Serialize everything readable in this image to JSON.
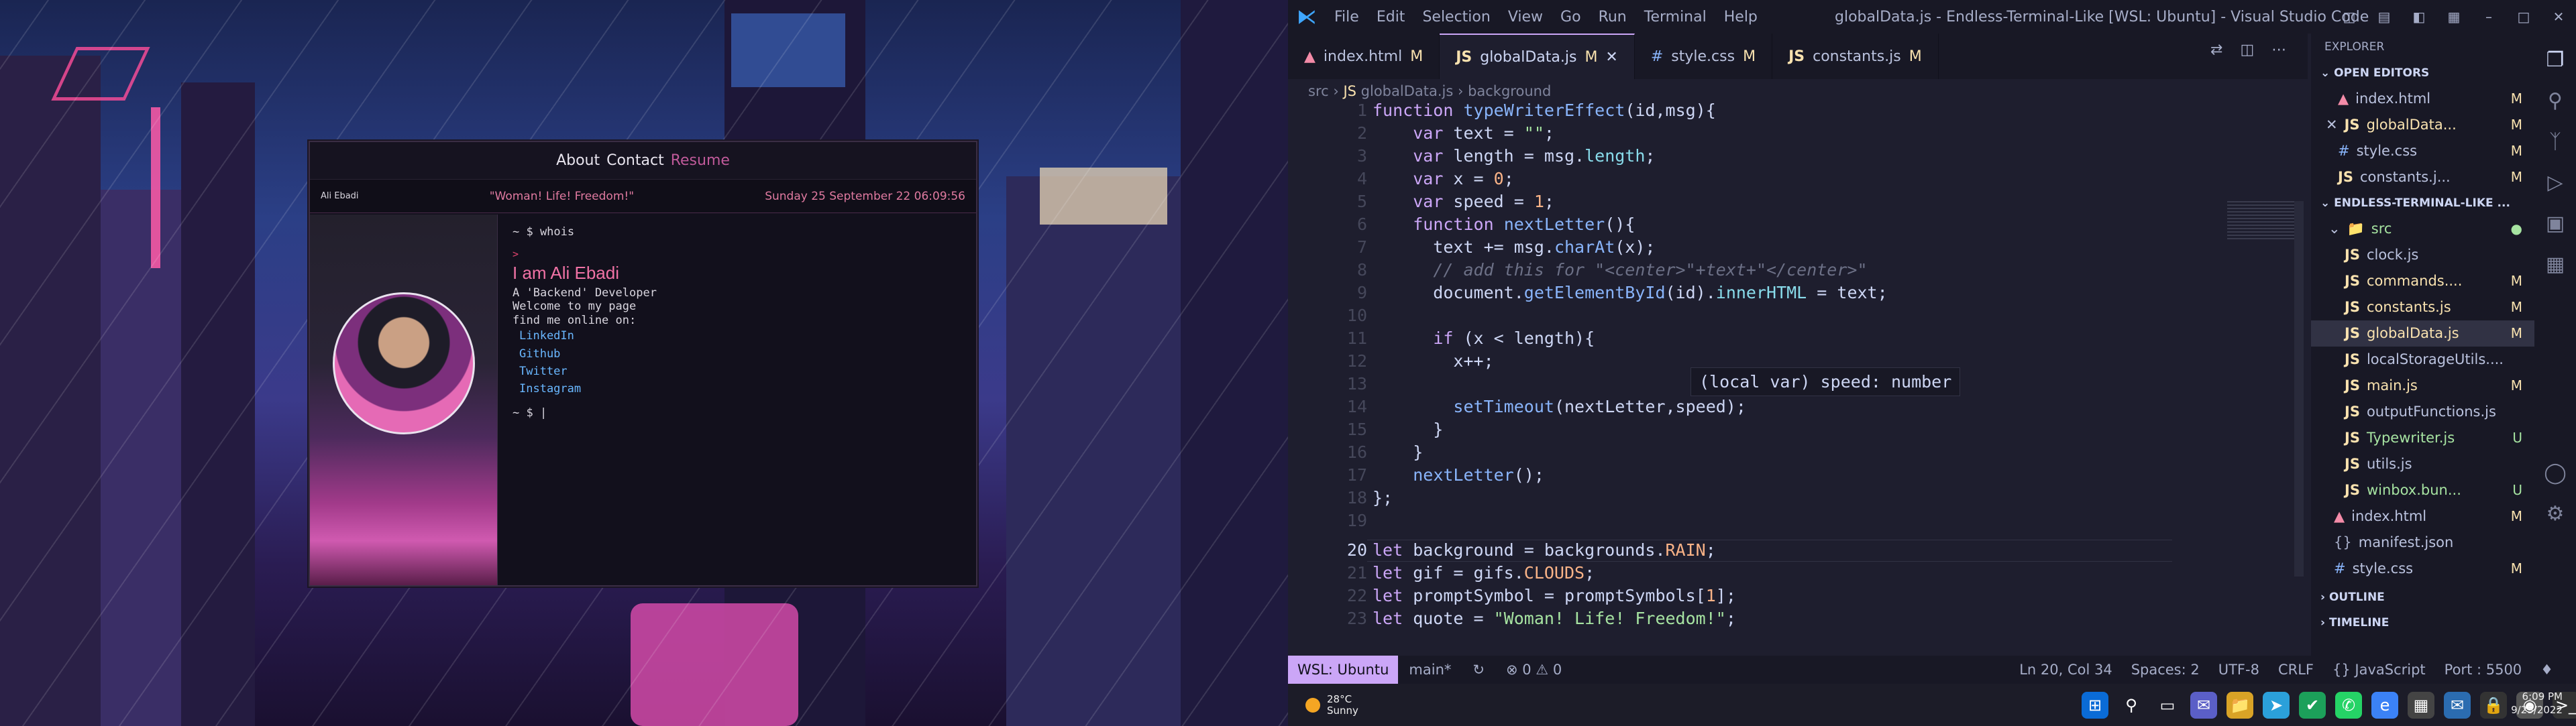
{
  "site": {
    "nav": {
      "about": "About",
      "contact": "Contact",
      "resume": "Resume"
    },
    "name": "Ali Ebadi",
    "quote": "\"Woman! Life! Freedom!\"",
    "clock": "Sunday 25 September 22 06:09:56",
    "terminal": {
      "cmd": "~ $ whois",
      "caret": ">",
      "iam": "I am Ali Ebadi",
      "role": "A 'Backend' Developer",
      "welcome": "Welcome to my page",
      "online": "find me online on:",
      "links": [
        "LinkedIn",
        "Github",
        "Twitter",
        "Instagram"
      ],
      "prompt": "~ $ |"
    }
  },
  "vscode": {
    "menu": [
      "File",
      "Edit",
      "Selection",
      "View",
      "Go",
      "Run",
      "Terminal",
      "Help"
    ],
    "window_title": "globalData.js - Endless-Terminal-Like [WSL: Ubuntu] - Visual Studio Code",
    "tabs": [
      {
        "name": "index.html",
        "badge": "M"
      },
      {
        "name": "globalData.js",
        "badge": "M"
      },
      {
        "name": "style.css",
        "badge": "M"
      },
      {
        "name": "constants.js",
        "badge": "M"
      }
    ],
    "breadcrumb": {
      "folder": "src",
      "file": "globalData.js",
      "symbol": "background"
    },
    "hover": "(local var) speed: number",
    "explorer": {
      "title": "EXPLORER",
      "open_editors": "OPEN EDITORS",
      "open_files": [
        {
          "name": "index.html",
          "badge": "M"
        },
        {
          "name": "globalData...",
          "badge": "M"
        },
        {
          "name": "style.css",
          "badge": "M"
        },
        {
          "name": "constants.j...",
          "badge": "M"
        }
      ],
      "project": "ENDLESS-TERMINAL-LIKE ...",
      "src": "src",
      "files": [
        {
          "name": "clock.js",
          "badge": ""
        },
        {
          "name": "commands....",
          "badge": "M"
        },
        {
          "name": "constants.js",
          "badge": "M"
        },
        {
          "name": "globalData.js",
          "badge": "M"
        },
        {
          "name": "localStorageUtils....",
          "badge": ""
        },
        {
          "name": "main.js",
          "badge": "M"
        },
        {
          "name": "outputFunctions.js",
          "badge": ""
        },
        {
          "name": "Typewriter.js",
          "badge": "U"
        },
        {
          "name": "utils.js",
          "badge": ""
        },
        {
          "name": "winbox.bun...",
          "badge": "U"
        }
      ],
      "root_files": [
        {
          "name": "index.html",
          "badge": "M"
        },
        {
          "name": "manifest.json",
          "badge": ""
        },
        {
          "name": "style.css",
          "badge": "M"
        }
      ],
      "outline": "OUTLINE",
      "timeline": "TIMELINE"
    },
    "status": {
      "remote": "WSL: Ubuntu",
      "branch": "main*",
      "problems": "⊗ 0 ⚠ 0",
      "position": "Ln 20, Col 34",
      "spaces": "Spaces: 2",
      "encoding": "UTF-8",
      "eol": "CRLF",
      "language": "{} JavaScript",
      "port": "Port : 5500"
    }
  },
  "taskbar": {
    "temp": "28°C",
    "weather": "Sunny",
    "time": "6:09 PM",
    "date": "9/25/2022"
  }
}
